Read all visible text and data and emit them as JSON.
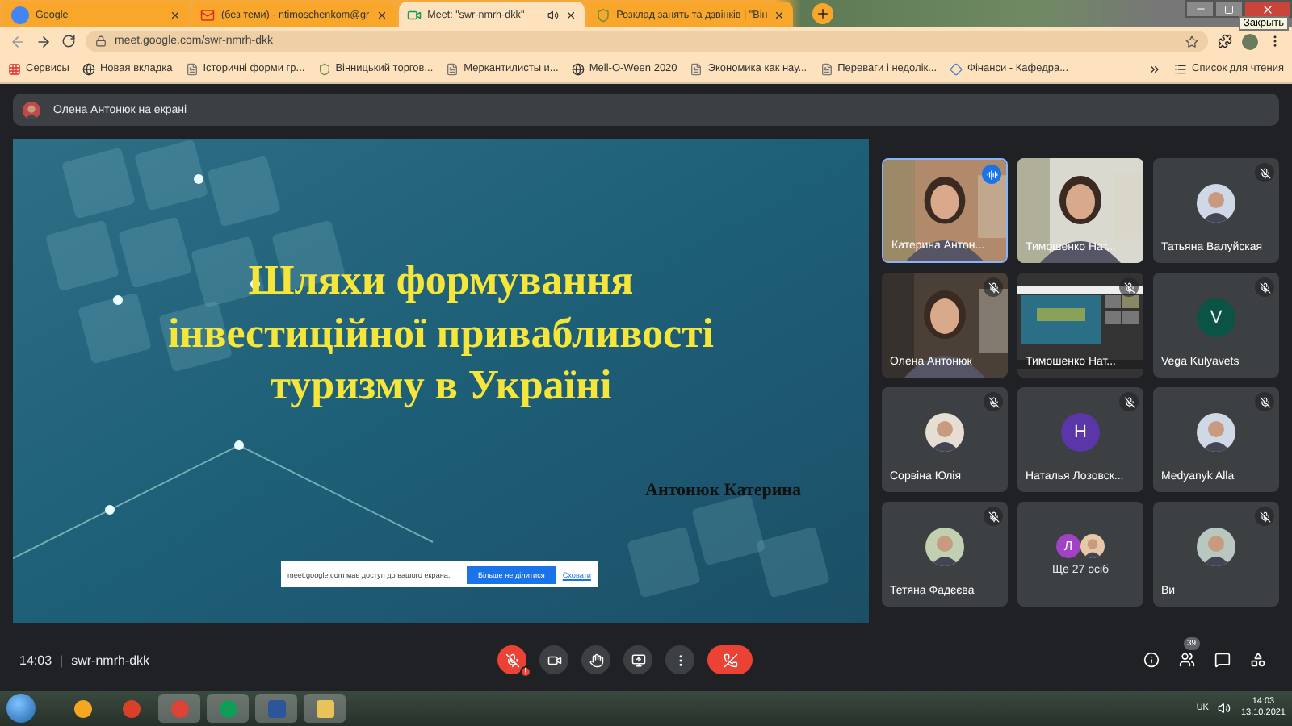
{
  "tabs": [
    {
      "label": "Google",
      "selected": false,
      "audio": false
    },
    {
      "label": "(без теми) - ntimoschenkom@gr",
      "selected": false,
      "audio": false
    },
    {
      "label": "Meet: \"swr-nmrh-dkk\"",
      "selected": true,
      "audio": true
    },
    {
      "label": "Розклад занять та дзвінків | \"Він",
      "selected": false,
      "audio": false
    }
  ],
  "window_tooltip": "Закрыть",
  "address": "meet.google.com/swr-nmrh-dkk",
  "bookmarks": [
    "Сервисы",
    "Новая вкладка",
    "Історичні форми гр...",
    "Вінницький торгов...",
    "Меркантилисты и...",
    "Mell-O-Ween 2020",
    "Экономика как нау...",
    "Переваги і недолік...",
    "Фінанси - Кафедра..."
  ],
  "reading_list": "Список для чтения",
  "presenter": "Олена Антонюк на екрані",
  "slide": {
    "title": [
      "Шляхи формування",
      "інвестиційної привабливості",
      "туризму в Україні"
    ],
    "author": "Антонюк Катерина"
  },
  "share_notice": {
    "text": "meet.google.com має доступ до вашого екрана.",
    "stop": "Більше не ділитися",
    "hide": "Сховати"
  },
  "tiles": [
    {
      "kind": "video",
      "name": "Катерина Антон...",
      "muted": false,
      "speaking": true
    },
    {
      "kind": "video",
      "name": "Тимошенко Нат...",
      "muted": false,
      "speaking": false
    },
    {
      "name": "Татьяна Валуйская",
      "muted": true,
      "speaking": false
    },
    {
      "kind": "video",
      "name": "Олена Антонюк",
      "muted": true,
      "speaking": false
    },
    {
      "kind": "screen",
      "name": "Тимошенко Нат...",
      "muted": true,
      "speaking": false
    },
    {
      "kind": "letter",
      "name": "Vega Kulyavets",
      "letter": "V",
      "color": "#0b5345",
      "muted": true,
      "speaking": false
    },
    {
      "name": "Сорвіна Юлія",
      "muted": true,
      "speaking": false
    },
    {
      "kind": "letter",
      "name": "Наталья Лозовск...",
      "letter": "Н",
      "color": "#5b36a8",
      "muted": true,
      "speaking": false
    },
    {
      "name": "Medyanyk Alla",
      "muted": true,
      "speaking": false
    },
    {
      "name": "Тетяна Фадєєва",
      "muted": true,
      "speaking": false
    },
    {
      "kind": "more",
      "name": "Ще 27 осіб",
      "letter": "Л",
      "color": "#a142c4",
      "muted": false,
      "speaking": false
    },
    {
      "name": "Ви",
      "muted": true,
      "speaking": false
    }
  ],
  "meeting": {
    "time": "14:03",
    "separator": "|",
    "code": "swr-nmrh-dkk",
    "mic_alert": "!",
    "participants": "39"
  },
  "taskbar": {
    "language": "UK",
    "time": "14:03",
    "date": "13.10.2021"
  }
}
